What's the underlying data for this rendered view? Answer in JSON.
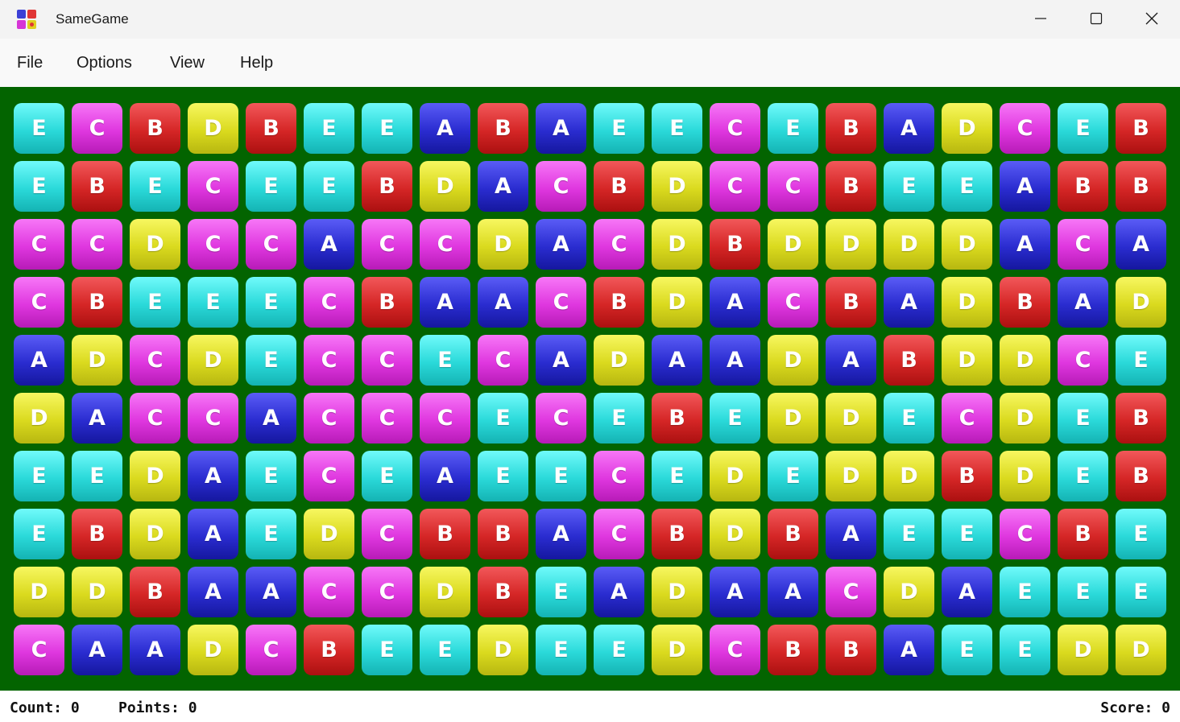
{
  "window": {
    "title": "SameGame",
    "icon": "samegame-app-icon"
  },
  "menu": {
    "items": [
      "File",
      "Options",
      "View",
      "Help"
    ]
  },
  "board": {
    "rows": 10,
    "cols": 20,
    "colors": {
      "A": "#2a2cd0",
      "B": "#d52626",
      "C": "#df37df",
      "D": "#dada1e",
      "E": "#2ad9d9"
    },
    "background": "#036400",
    "grid": [
      "ECBDBEEABAEECEBADCEB",
      "EBECEEBDACBDCCBEEABB",
      "CCDCCACCDACDBDDDDACA",
      "CBEEECBAACBDACBADBAD",
      "ADCDECCECADAADABDDCE",
      "DACCACCCECEBEDDECDEB",
      "EEDAECEAEECEDEDDBDEB",
      "EBDAEDCBBACBDBAEECBE",
      "DDBAACCDBEADAACDAEEE",
      "CAADCBEEDEEDCBBAEEDD"
    ]
  },
  "status": {
    "count": "Count: 0",
    "points": "Points: 0",
    "score": "Score: 0"
  }
}
